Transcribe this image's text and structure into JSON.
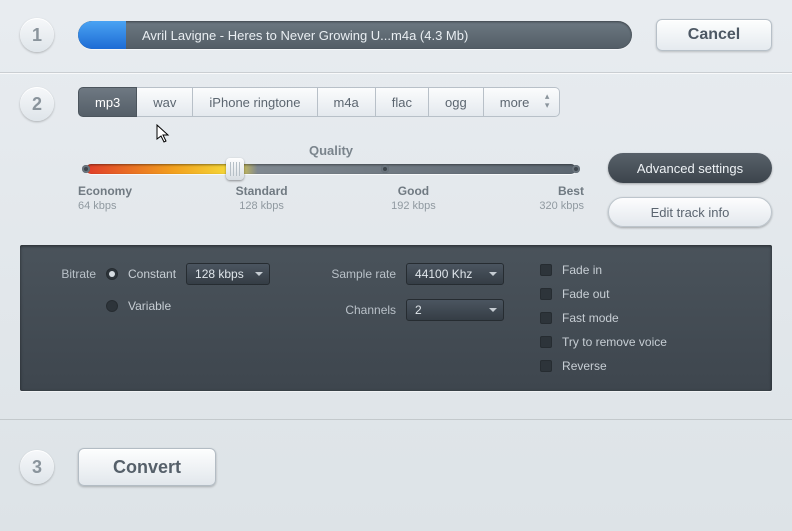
{
  "step1": {
    "file_label": "Avril Lavigne - Heres to Never Growing U...m4a (4.3 Mb)",
    "cancel": "Cancel"
  },
  "step2": {
    "tabs": {
      "mp3": "mp3",
      "wav": "wav",
      "iphone": "iPhone ringtone",
      "m4a": "m4a",
      "flac": "flac",
      "ogg": "ogg",
      "more": "more"
    },
    "quality": {
      "title": "Quality",
      "labels": {
        "economy": {
          "name": "Economy",
          "kbps": "64 kbps"
        },
        "standard": {
          "name": "Standard",
          "kbps": "128 kbps"
        },
        "good": {
          "name": "Good",
          "kbps": "192 kbps"
        },
        "best": {
          "name": "Best",
          "kbps": "320 kbps"
        }
      }
    },
    "advanced_settings": "Advanced settings",
    "edit_track_info": "Edit track info"
  },
  "adv": {
    "bitrate_label": "Bitrate",
    "bitrate_constant": "Constant",
    "bitrate_variable": "Variable",
    "bitrate_value": "128 kbps",
    "sample_rate_label": "Sample rate",
    "sample_rate_value": "44100 Khz",
    "channels_label": "Channels",
    "channels_value": "2",
    "fade_in": "Fade in",
    "fade_out": "Fade out",
    "fast_mode": "Fast mode",
    "remove_voice": "Try to remove voice",
    "reverse": "Reverse"
  },
  "step3": {
    "convert": "Convert"
  }
}
